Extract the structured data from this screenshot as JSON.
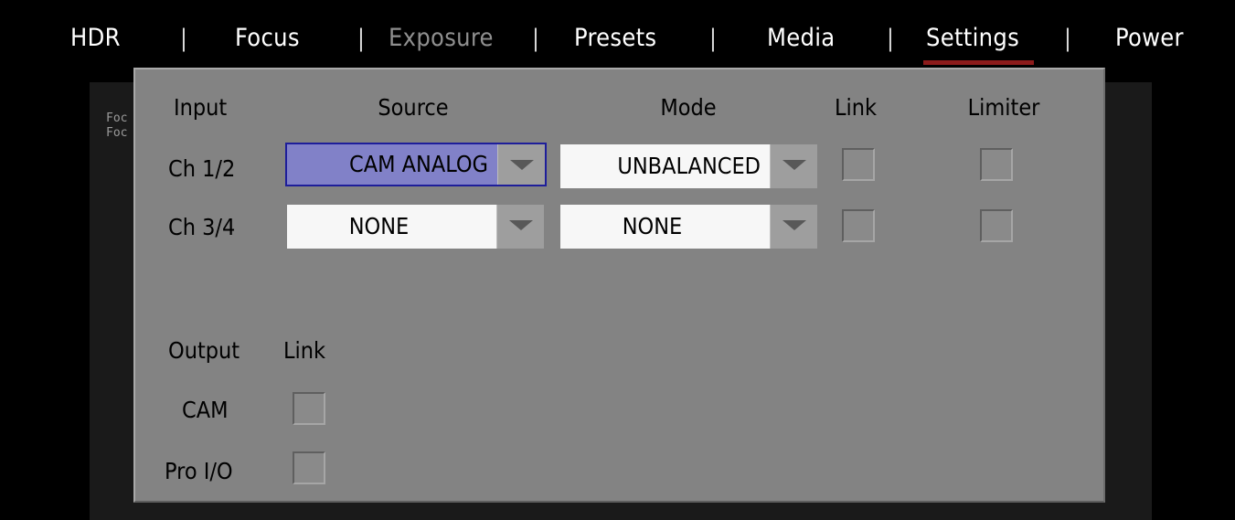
{
  "menu": {
    "tabs": [
      {
        "label": "HDR",
        "state": "normal"
      },
      {
        "label": "Focus",
        "state": "normal"
      },
      {
        "label": "Exposure",
        "state": "disabled"
      },
      {
        "label": "Presets",
        "state": "normal"
      },
      {
        "label": "Media",
        "state": "normal"
      },
      {
        "label": "Settings",
        "state": "active"
      },
      {
        "label": "Power",
        "state": "normal"
      }
    ],
    "separator": "|"
  },
  "background": {
    "line1": "Foc",
    "line2": "Foc"
  },
  "dialog": {
    "input_section": {
      "headers": {
        "input": "Input",
        "source": "Source",
        "mode": "Mode",
        "link": "Link",
        "limiter": "Limiter"
      },
      "rows": [
        {
          "label": "Ch 1/2",
          "source": "CAM ANALOG",
          "source_selected": true,
          "mode": "UNBALANCED",
          "link_checked": false,
          "limiter_checked": false
        },
        {
          "label": "Ch 3/4",
          "source": "NONE",
          "source_selected": false,
          "mode": "NONE",
          "link_checked": false,
          "limiter_checked": false
        }
      ]
    },
    "output_section": {
      "headers": {
        "output": "Output",
        "link": "Link"
      },
      "rows": [
        {
          "label": "CAM",
          "link_checked": false
        },
        {
          "label": "Pro I/O",
          "link_checked": false
        }
      ]
    }
  },
  "colors": {
    "dialog_bg": "#838383",
    "active_underline": "#8c1b1b",
    "selected_dropdown": "#8181c8",
    "selected_border": "#1e1e9a",
    "disabled_tab": "#8f8f8f"
  },
  "icons": {
    "dropdown_arrow": "chevron-down-icon"
  }
}
